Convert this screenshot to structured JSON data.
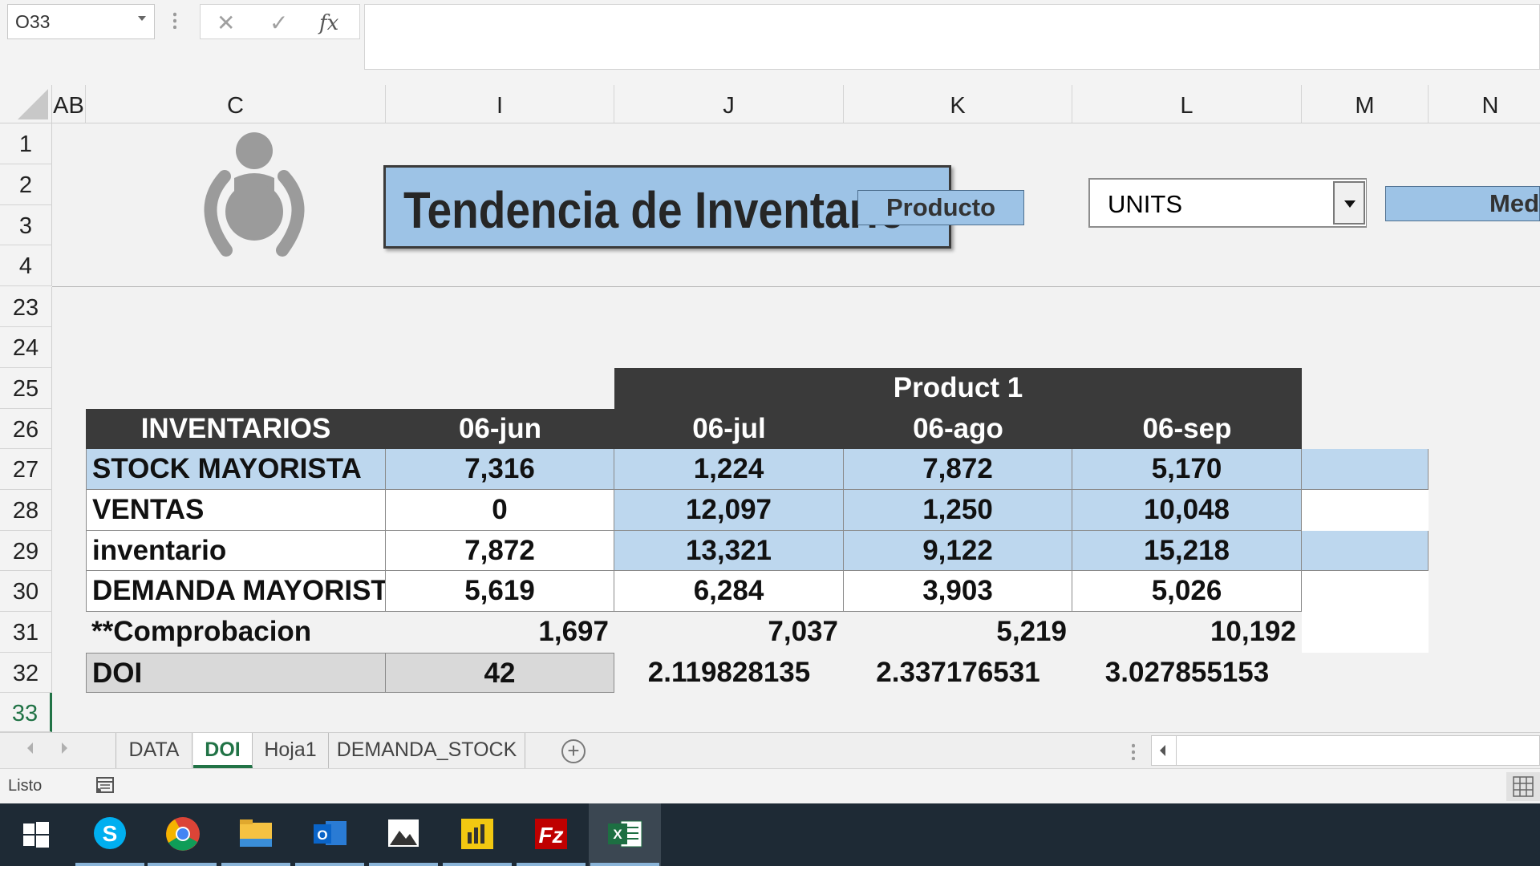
{
  "formula_bar": {
    "name_box": "O33",
    "cancel_icon": "✕",
    "enter_icon": "✓",
    "function_icon": "fx",
    "formula": ""
  },
  "columns": [
    "AB",
    "C",
    "I",
    "J",
    "K",
    "L",
    "M",
    "N"
  ],
  "rows": [
    "1",
    "2",
    "3",
    "4",
    "23",
    "24",
    "25",
    "26",
    "27",
    "28",
    "29",
    "30",
    "31",
    "32",
    "33"
  ],
  "dashboard": {
    "title": "Tendencia de Inventario",
    "producto_button": "Producto",
    "units_select": "UNITS",
    "med_button": "Med"
  },
  "table": {
    "product_header": "Product 1",
    "header_label": "INVENTARIOS",
    "dates": [
      "06-jun",
      "06-jul",
      "06-ago",
      "06-sep"
    ],
    "rows": [
      {
        "label": "STOCK MAYORISTA",
        "values": [
          "7,316",
          "1,224",
          "7,872",
          "5,170"
        ]
      },
      {
        "label": "VENTAS",
        "values": [
          "0",
          "12,097",
          "1,250",
          "10,048"
        ]
      },
      {
        "label": "inventario",
        "values": [
          "7,872",
          "13,321",
          "9,122",
          "15,218"
        ]
      },
      {
        "label": "DEMANDA MAYORISTA",
        "values": [
          "5,619",
          "6,284",
          "3,903",
          "5,026"
        ]
      },
      {
        "label": "**Comprobacion",
        "values": [
          "1,697",
          "7,037",
          "5,219",
          "10,192"
        ]
      },
      {
        "label": "DOI",
        "values": [
          "42",
          "2.119828135",
          "2.337176531",
          "3.027855153"
        ]
      }
    ]
  },
  "sheet_tabs": [
    "DATA",
    "DOI",
    "Hoja1",
    "DEMANDA_STOCK"
  ],
  "active_tab": "DOI",
  "status": "Listo",
  "taskbar": [
    "start-icon",
    "skype-icon",
    "chrome-icon",
    "file-explorer-icon",
    "outlook-icon",
    "photos-icon",
    "power-bi-icon",
    "filezilla-icon",
    "excel-icon"
  ],
  "colors": {
    "accent": "#217346",
    "header_dark": "#3a3a3a",
    "cell_blue": "#bdd7ee",
    "title_blue": "#9dc3e6"
  }
}
